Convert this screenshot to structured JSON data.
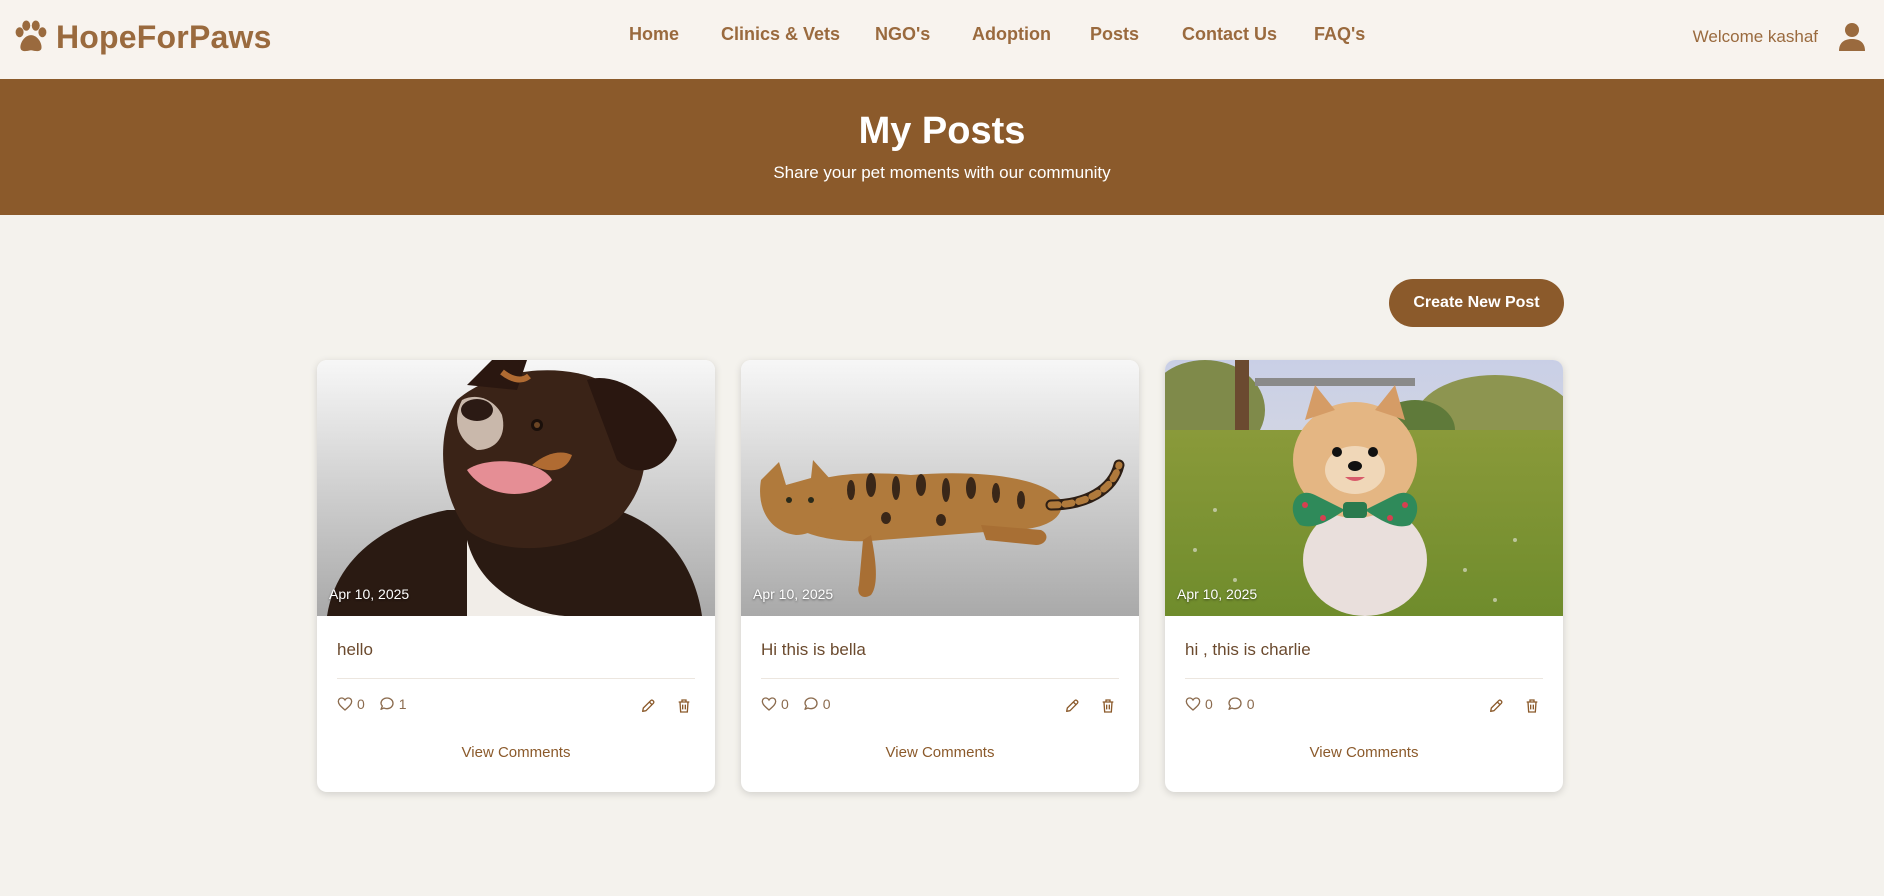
{
  "navbar": {
    "brand": "HopeForPaws",
    "links": [
      "Home",
      "Clinics & Vets",
      "NGO's",
      "Adoption",
      "Posts",
      "Contact Us",
      "FAQ's"
    ],
    "welcome": "Welcome kashaf"
  },
  "hero": {
    "title": "My Posts",
    "subtitle": "Share your pet moments with our community"
  },
  "create_button": "Create New Post",
  "posts": [
    {
      "date": "Apr 10, 2025",
      "caption": "hello",
      "likes": "0",
      "comments": "1",
      "view_comments": "View Comments"
    },
    {
      "date": "Apr 10, 2025",
      "caption": "Hi this is bella",
      "likes": "0",
      "comments": "0",
      "view_comments": "View Comments"
    },
    {
      "date": "Apr 10, 2025",
      "caption": "hi , this is charlie",
      "likes": "0",
      "comments": "0",
      "view_comments": "View Comments"
    }
  ],
  "colors": {
    "brand_brown": "#8b5a2b",
    "nav_text": "#9a6a3e",
    "page_bg": "#f4f2ed",
    "nav_bg": "#f8f3ee"
  },
  "icons": {
    "logo": "paw-icon",
    "user": "user-icon",
    "like": "heart-icon",
    "comment": "comment-icon",
    "edit": "pencil-icon",
    "delete": "trash-icon"
  }
}
